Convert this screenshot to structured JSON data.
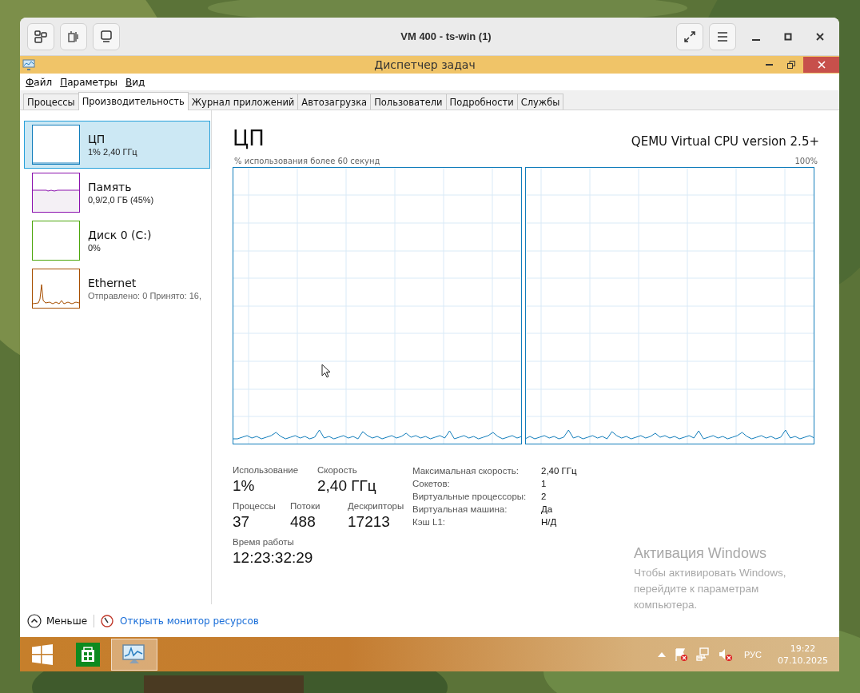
{
  "host_window": {
    "title": "VM 400 - ts-win (1)"
  },
  "app": {
    "title": "Диспетчер задач"
  },
  "menu": [
    "Файл",
    "Параметры",
    "Вид"
  ],
  "tabs": [
    {
      "label": "Процессы",
      "selected": false
    },
    {
      "label": "Производительность",
      "selected": true
    },
    {
      "label": "Журнал приложений",
      "selected": false
    },
    {
      "label": "Автозагрузка",
      "selected": false
    },
    {
      "label": "Пользователи",
      "selected": false
    },
    {
      "label": "Подробности",
      "selected": false
    },
    {
      "label": "Службы",
      "selected": false
    }
  ],
  "sidebar": [
    {
      "kind": "cpu",
      "name": "ЦП",
      "detail": "1% 2,40 ГГц",
      "selected": true,
      "color": "#117dbb"
    },
    {
      "kind": "memory",
      "name": "Память",
      "detail": "0,9/2,0 ГБ (45%)",
      "selected": false,
      "color": "#8b12ae"
    },
    {
      "kind": "disk",
      "name": "Диск 0 (C:)",
      "detail": "0%",
      "selected": false,
      "color": "#4da60c"
    },
    {
      "kind": "network",
      "name": "Ethernet",
      "detail": "Отправлено: 0 Принято: 16,",
      "selected": false,
      "color": "#a74f01"
    }
  ],
  "cpu_panel": {
    "title": "ЦП",
    "model": "QEMU Virtual CPU version 2.5+",
    "graph_caption": "% использования более 60 секунд",
    "graph_max": "100%",
    "stats": [
      [
        {
          "label": "Использование",
          "value": "1%"
        },
        {
          "label": "Скорость",
          "value": "2,40 ГГц"
        }
      ],
      [
        {
          "label": "Процессы",
          "value": "37"
        },
        {
          "label": "Потоки",
          "value": "488"
        },
        {
          "label": "Дескрипторы",
          "value": "17213"
        }
      ],
      [
        {
          "label": "Время работы",
          "value": "12:23:32:29"
        }
      ]
    ],
    "details": [
      {
        "label": "Максимальная скорость:",
        "value": "2,40 ГГц"
      },
      {
        "label": "Сокетов:",
        "value": "1"
      },
      {
        "label": "Виртуальные процессоры:",
        "value": "2"
      },
      {
        "label": "Виртуальная машина:",
        "value": "Да"
      },
      {
        "label": "Кэш L1:",
        "value": "Н/Д"
      }
    ]
  },
  "footer": {
    "less": "Меньше",
    "monitor_link": "Открыть монитор ресурсов"
  },
  "activation": {
    "title": "Активация Windows",
    "text": "Чтобы активировать Windows, перейдите к параметрам компьютера."
  },
  "taskbar": {
    "language": "РУС",
    "time": "19:22",
    "date": "07.10.2025"
  }
}
